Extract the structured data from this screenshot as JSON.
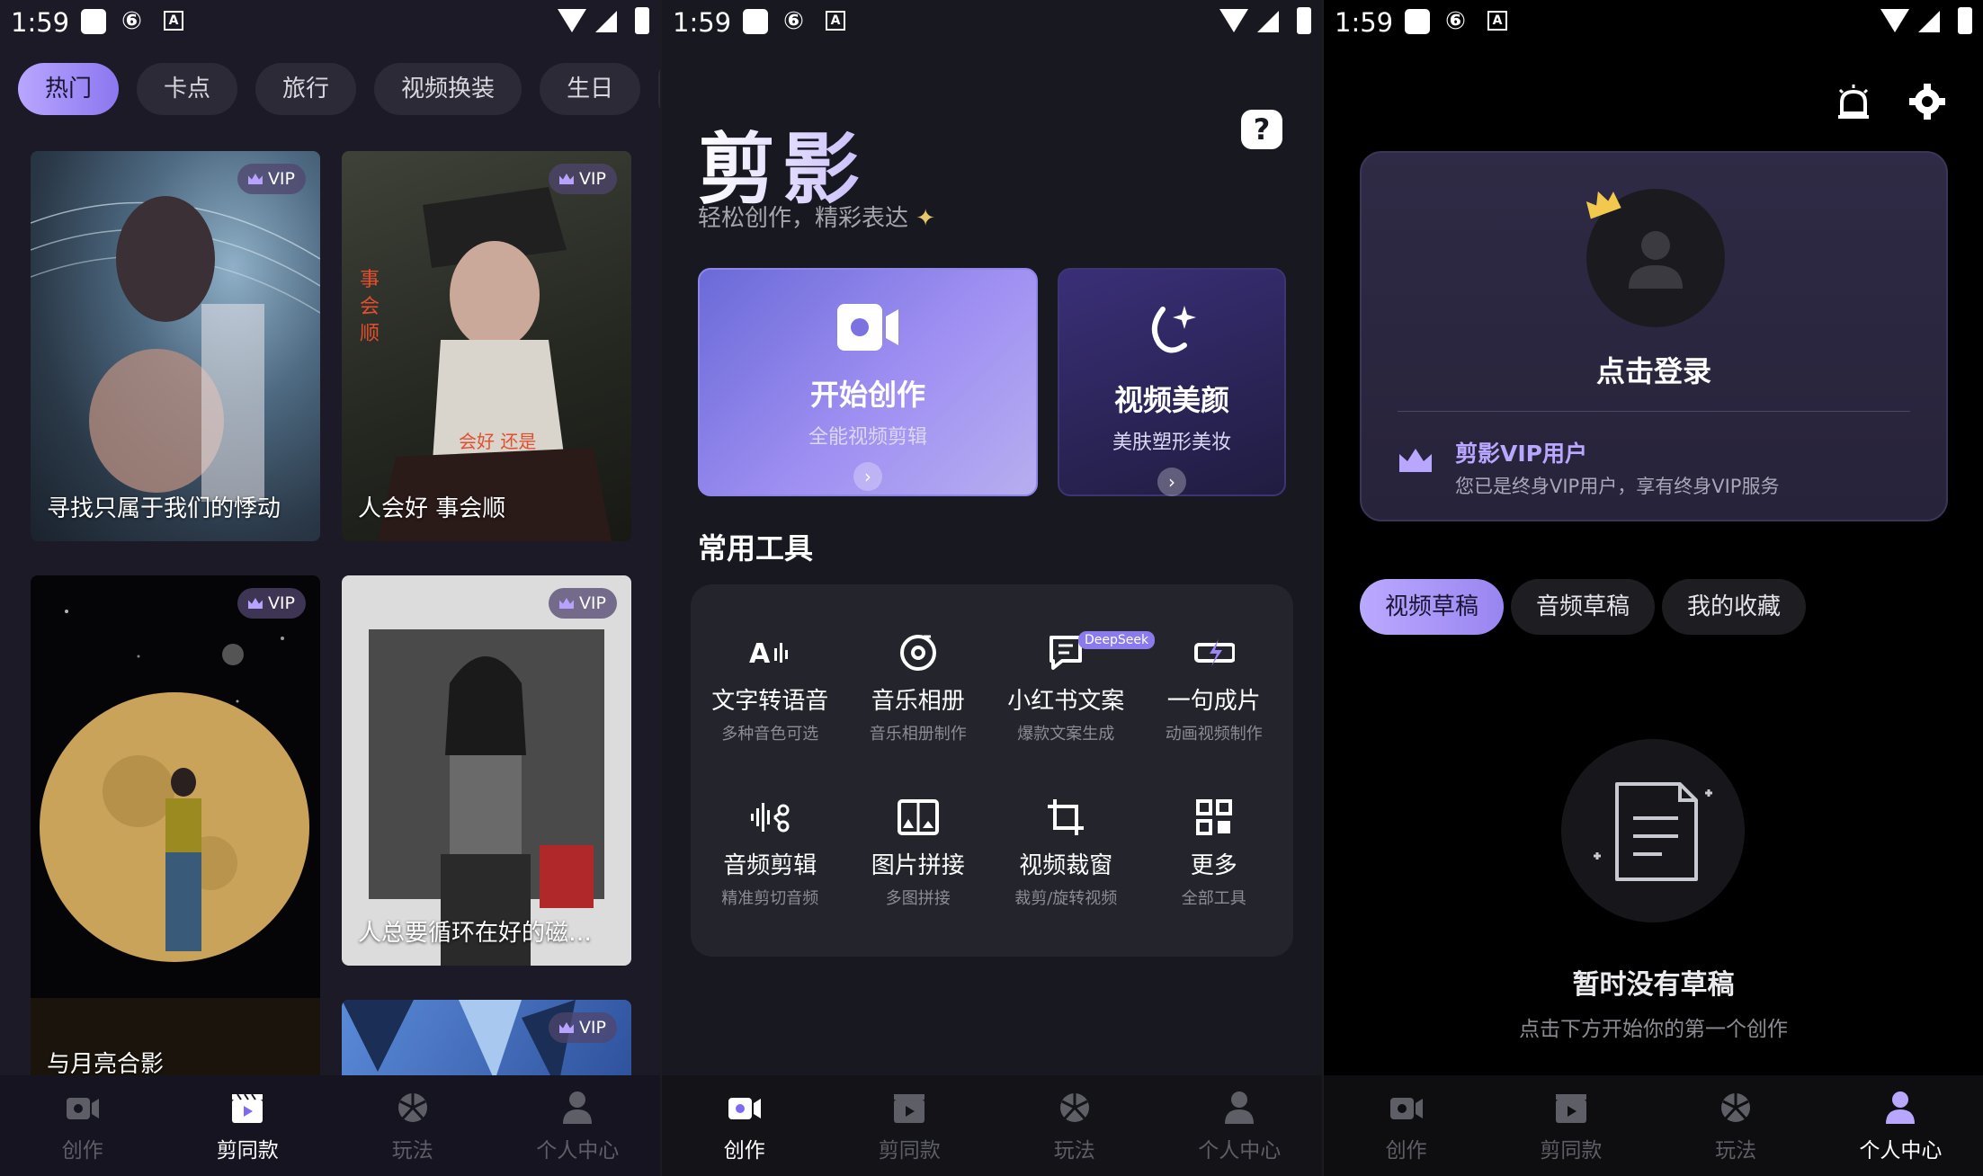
{
  "status": {
    "time": "1:59",
    "badge": "A"
  },
  "nav": [
    {
      "label": "创作",
      "icon": "camera-icon"
    },
    {
      "label": "剪同款",
      "icon": "clapper-icon"
    },
    {
      "label": "玩法",
      "icon": "aperture-icon"
    },
    {
      "label": "个人中心",
      "icon": "person-icon"
    }
  ],
  "templates": {
    "tabs": [
      "热门",
      "卡点",
      "旅行",
      "视频换装",
      "生日"
    ],
    "vip_label": "VIP",
    "cards": [
      {
        "caption": "寻找只属于我们的悸动",
        "vip": true
      },
      {
        "caption": "人会好 事会顺",
        "vip": true
      },
      {
        "caption": "与月亮合影",
        "vip": true
      },
      {
        "caption": "人总要循环在好的磁…",
        "vip": true
      },
      {
        "caption": "",
        "vip": true
      }
    ]
  },
  "create": {
    "logo": "剪影",
    "slogan": "轻松创作，精彩表达",
    "start": {
      "title": "开始创作",
      "subtitle": "全能视频剪辑"
    },
    "beauty": {
      "title": "视频美颜",
      "subtitle": "美肤塑形美妆"
    },
    "section_title": "常用工具",
    "deepseek_badge": "DeepSeek",
    "tools": [
      {
        "name": "文字转语音",
        "desc": "多种音色可选",
        "icon": "text-to-speech-icon"
      },
      {
        "name": "音乐相册",
        "desc": "音乐相册制作",
        "icon": "music-disc-icon"
      },
      {
        "name": "小红书文案",
        "desc": "爆款文案生成",
        "icon": "note-icon"
      },
      {
        "name": "一句成片",
        "desc": "动画视频制作",
        "icon": "bolt-film-icon"
      },
      {
        "name": "音频剪辑",
        "desc": "精准剪切音频",
        "icon": "waveform-icon"
      },
      {
        "name": "图片拼接",
        "desc": "多图拼接",
        "icon": "collage-icon"
      },
      {
        "name": "视频裁窗",
        "desc": "裁剪/旋转视频",
        "icon": "crop-icon"
      },
      {
        "name": "更多",
        "desc": "全部工具",
        "icon": "grid-icon"
      }
    ]
  },
  "profile": {
    "login": "点击登录",
    "vip_title": "剪影VIP用户",
    "vip_desc": "您已是终身VIP用户，享有终身VIP服务",
    "tabs": [
      "视频草稿",
      "音频草稿",
      "我的收藏"
    ],
    "empty_title": "暂时没有草稿",
    "empty_sub": "点击下方开始你的第一个创作"
  },
  "colors": {
    "accent": "#9b87f5",
    "accent_light": "#b9a6ff"
  }
}
